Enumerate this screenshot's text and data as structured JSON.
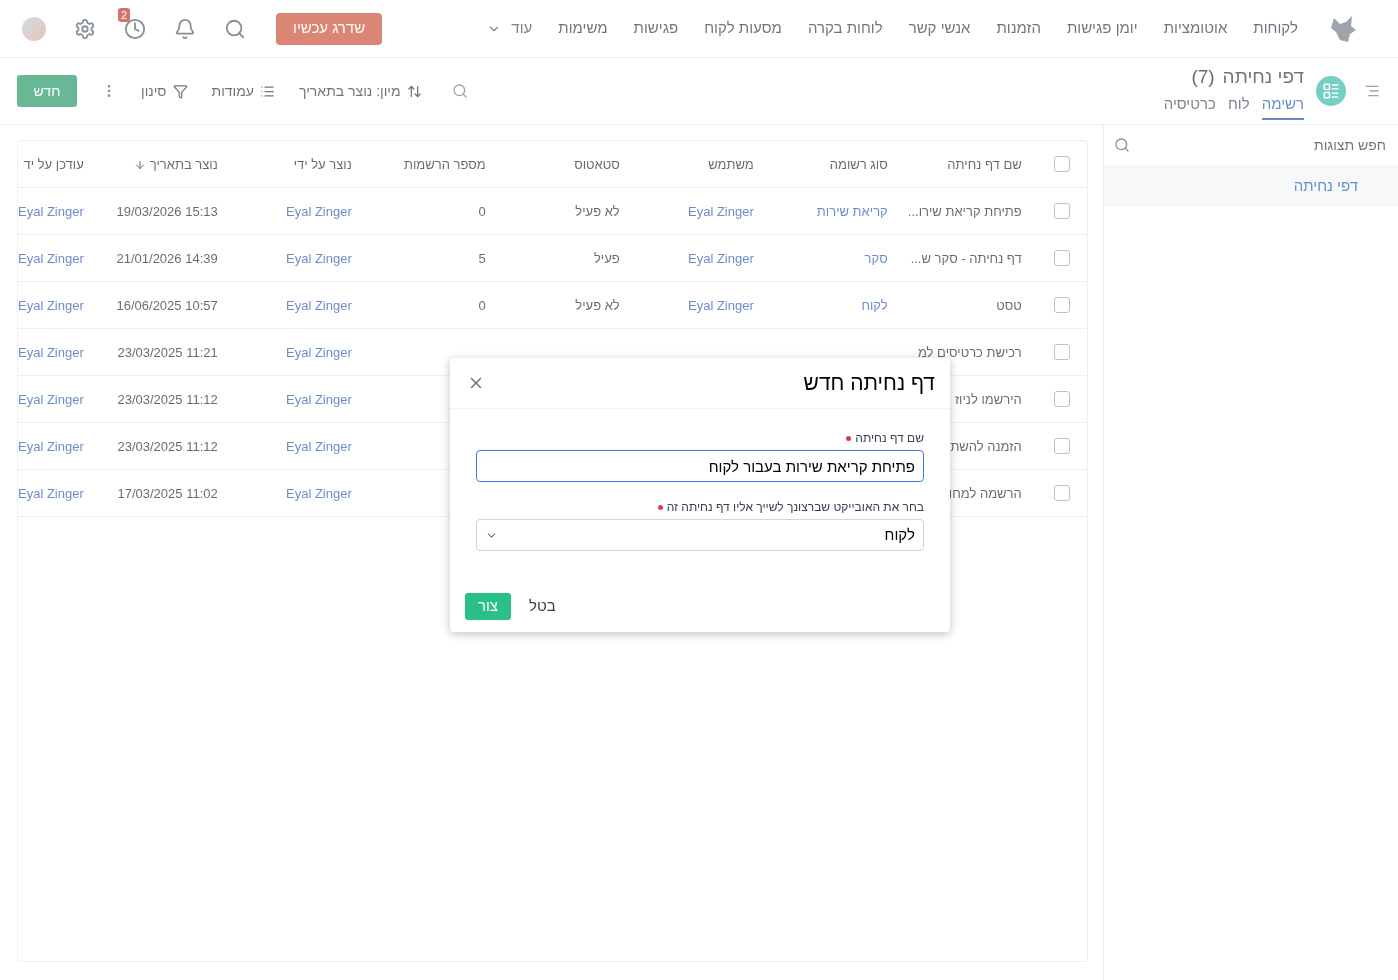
{
  "nav": {
    "items": [
      "לקוחות",
      "אוטומציות",
      "יומן פגישות",
      "הזמנות",
      "אנשי קשר",
      "לוחות בקרה",
      "מסעות לקוח",
      "פגישות",
      "משימות"
    ],
    "more": "עוד",
    "upgrade": "שדרג עכשיו",
    "history_badge": "2"
  },
  "page": {
    "title": "דפי נחיתה",
    "count": "(7)",
    "tabs": [
      {
        "label": "רשימה",
        "selected": true
      },
      {
        "label": "לוח",
        "selected": false
      },
      {
        "label": "כרטיסיה",
        "selected": false
      }
    ],
    "toolbar": {
      "sort": "מיון: נוצר בתאריך",
      "columns": "עמודות",
      "filter": "סינון",
      "new": "חדש"
    }
  },
  "sidebar": {
    "search_placeholder": "חפש תצוגות",
    "items": [
      {
        "label": "דפי נחיתה",
        "selected": true
      }
    ]
  },
  "table": {
    "all_checked": false,
    "columns": [
      {
        "label": "שם דף נחיתה",
        "kind": "text"
      },
      {
        "label": "סוג רשומה",
        "kind": "link"
      },
      {
        "label": "משתמש",
        "kind": "link"
      },
      {
        "label": "סטאטוס",
        "kind": "text"
      },
      {
        "label": "מספר הרשמות",
        "kind": "text"
      },
      {
        "label": "נוצר על ידי",
        "kind": "link"
      },
      {
        "label": "נוצר בתאריך",
        "kind": "text",
        "sorted": true
      },
      {
        "label": "עודכן על יד",
        "kind": "link"
      }
    ],
    "rows": [
      {
        "checked": false,
        "cells": [
          "פתיחת קריאת שירו...",
          "קריאת שירות",
          "Eyal Zinger",
          "לא פעיל",
          "0",
          "Eyal Zinger",
          "15:13 19/03/2026",
          "Eyal Zinger"
        ]
      },
      {
        "checked": false,
        "cells": [
          "דף נחיתה - סקר ש...",
          "סקר",
          "Eyal Zinger",
          "פעיל",
          "5",
          "Eyal Zinger",
          "14:39 21/01/2026",
          "Eyal Zinger"
        ]
      },
      {
        "checked": false,
        "cells": [
          "טסט",
          "לקוח",
          "Eyal Zinger",
          "לא פעיל",
          "0",
          "Eyal Zinger",
          "10:57 16/06/2025",
          "Eyal Zinger"
        ]
      },
      {
        "checked": false,
        "cells": [
          "רכישת כרטיסים למ",
          null,
          null,
          null,
          null,
          "Eyal Zinger",
          "11:21 23/03/2025",
          "Eyal Zinger"
        ]
      },
      {
        "checked": false,
        "cells": [
          "הירשמו לניוז",
          null,
          null,
          null,
          null,
          "Eyal Zinger",
          "11:12 23/03/2025",
          "Eyal Zinger"
        ]
      },
      {
        "checked": false,
        "cells": [
          "הזמנה להשת",
          null,
          null,
          null,
          null,
          "Eyal Zinger",
          "11:12 23/03/2025",
          "Eyal Zinger"
        ]
      },
      {
        "checked": false,
        "cells": [
          "הרשמה למחו",
          null,
          null,
          null,
          null,
          "Eyal Zinger",
          "11:02 17/03/2025",
          "Eyal Zinger"
        ]
      }
    ]
  },
  "modal": {
    "title": "דף נחיתה חדש",
    "fields": [
      {
        "kind": "text",
        "label": "שם דף נחיתה",
        "required": true,
        "focused": true,
        "value": "פתיחת קריאת שירות בעבור לקוח"
      },
      {
        "kind": "select",
        "label": "בחר את האובייקט שברצונך לשייך אליו דף נחיתה זה",
        "required": true,
        "focused": false,
        "value": "לקוח"
      }
    ],
    "buttons": [
      {
        "label": "בטל",
        "kind": "cancel"
      },
      {
        "label": "צור",
        "kind": "primary"
      }
    ]
  }
}
